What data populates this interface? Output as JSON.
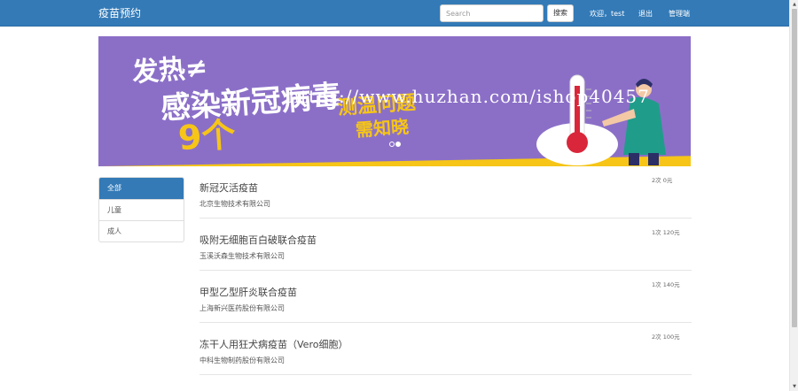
{
  "navbar": {
    "brand": "疫苗预约",
    "search_placeholder": "Search",
    "search_button": "搜索",
    "welcome": "欢迎，test",
    "logout": "退出",
    "admin": "管理端"
  },
  "colors": {
    "primary": "#337ab7",
    "banner_yellow": "#f6c517",
    "banner_purple": "#8b6fc7"
  },
  "banner": {
    "line1": "发热≠",
    "line2": "感染新冠病毒",
    "line3": "9个",
    "line4": "测温问题",
    "line5": "需知晓",
    "watermark": "https://www.huzhan.com/ishop40457",
    "slide_count": 2,
    "active_slide": 2
  },
  "categories": [
    {
      "label": "全部",
      "active": true
    },
    {
      "label": "儿童",
      "active": false
    },
    {
      "label": "成人",
      "active": false
    }
  ],
  "vaccines": [
    {
      "name": "新冠灭活疫苗",
      "company": "北京生物技术有限公司",
      "meta": "2次 0元"
    },
    {
      "name": "吸附无细胞百白破联合疫苗",
      "company": "玉溪沃森生物技术有限公司",
      "meta": "1次 120元"
    },
    {
      "name": "甲型乙型肝炎联合疫苗",
      "company": "上海新兴医药股份有限公司",
      "meta": "1次 140元"
    },
    {
      "name": "冻干人用狂犬病疫苗（Vero细胞）",
      "company": "中科生物制药股份有限公司",
      "meta": "2次 100元"
    }
  ]
}
